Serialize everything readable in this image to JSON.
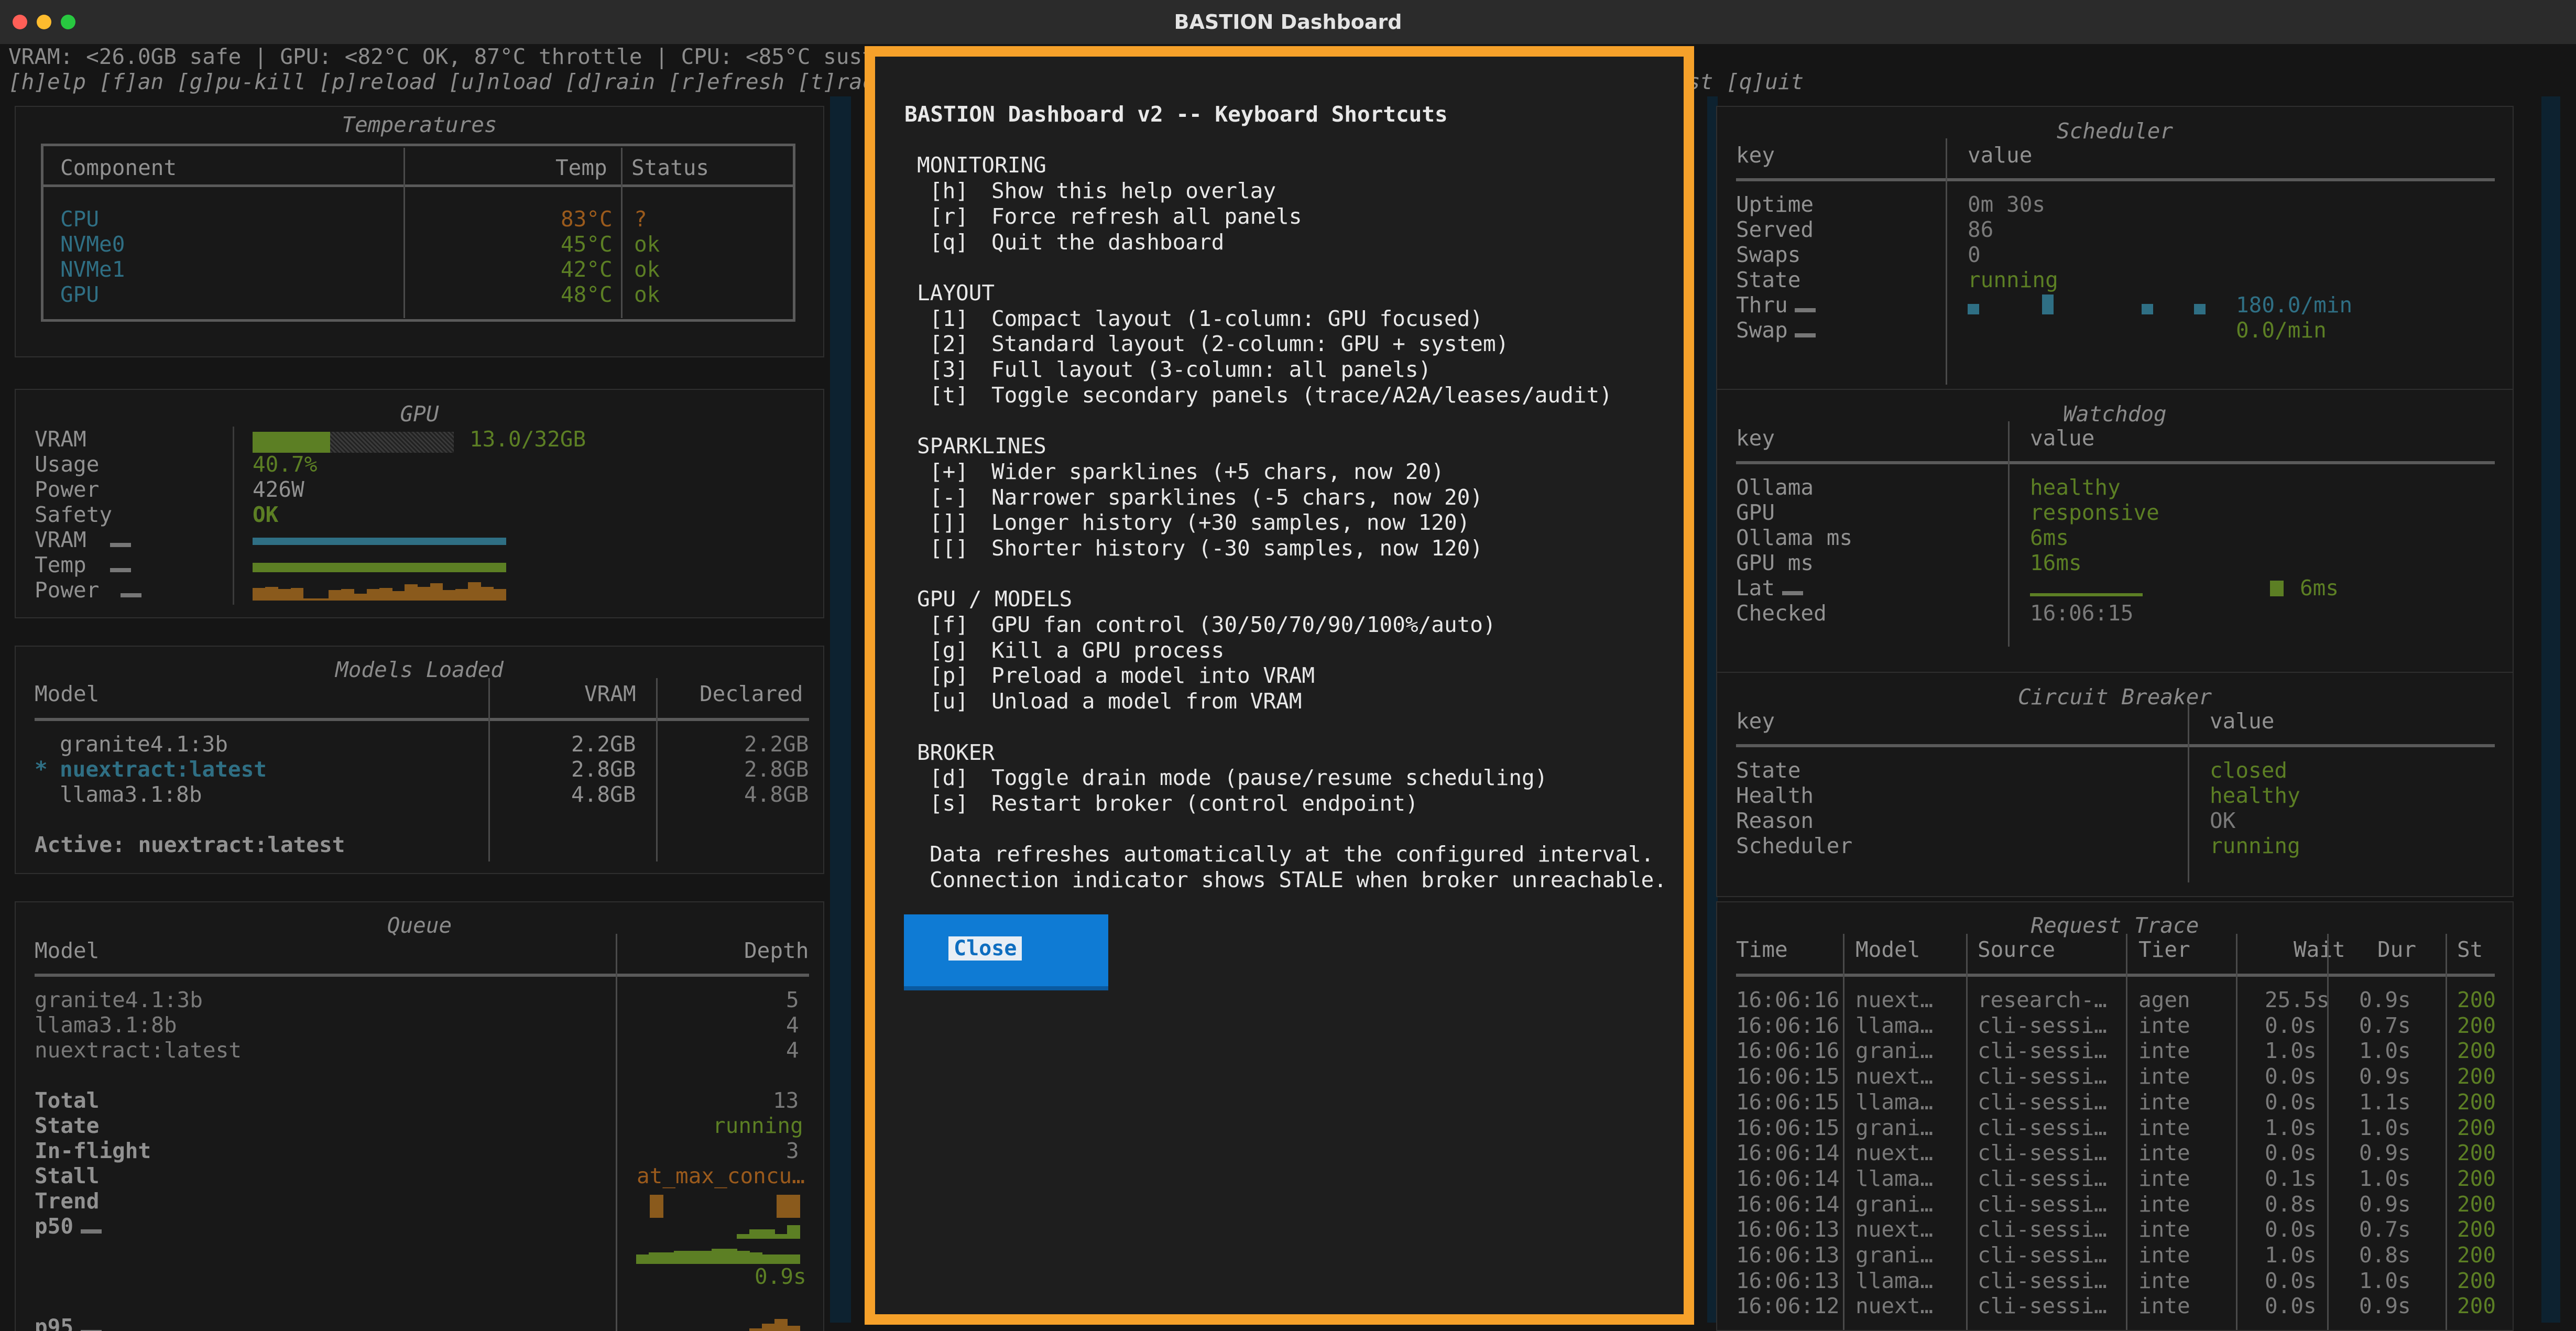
{
  "window": {
    "title": "BASTION Dashboard"
  },
  "status_line": "VRAM: <26.0GB safe | GPU: <82°C OK, 87°C throttle | CPU: <85°C sust",
  "keys_line": {
    "left": "[h]elp [f]an [g]pu-kill [p]reload [u]nload [d]rain [r]efresh [t]rac",
    "right": "st [q]uit"
  },
  "temperatures": {
    "title": "Temperatures",
    "headers": [
      "Component",
      "Temp",
      "Status"
    ],
    "rows": [
      {
        "component": "CPU",
        "temp": "83°C",
        "status": "?"
      },
      {
        "component": "NVMe0",
        "temp": "45°C",
        "status": "ok"
      },
      {
        "component": "NVMe1",
        "temp": "42°C",
        "status": "ok"
      },
      {
        "component": "GPU",
        "temp": "48°C",
        "status": "ok"
      }
    ]
  },
  "gpu": {
    "title": "GPU",
    "vram_label": "VRAM",
    "vram_value": "13.0/32GB",
    "vram_fraction": 0.406,
    "usage_label": "Usage",
    "usage_value": "40.7%",
    "power_label": "Power",
    "power_value": "426W",
    "safety_label": "Safety",
    "safety_value": "OK",
    "spark_vram": "VRAM",
    "spark_temp": "Temp",
    "spark_power": "Power",
    "power_spark": [
      0.55,
      0.6,
      0.5,
      0.55,
      0.1,
      0.1,
      0.45,
      0.5,
      0.3,
      0.5,
      0.55,
      0.4,
      0.7,
      0.6,
      0.75,
      0.45,
      0.5,
      0.8,
      0.6,
      0.5
    ]
  },
  "models_loaded": {
    "title": "Models Loaded",
    "headers": [
      "Model",
      "VRAM",
      "Declared"
    ],
    "rows": [
      {
        "marker": " ",
        "model": "granite4.1:3b",
        "vram": "2.2GB",
        "declared": "2.2GB"
      },
      {
        "marker": "*",
        "model": "nuextract:latest",
        "vram": "2.8GB",
        "declared": "2.8GB"
      },
      {
        "marker": " ",
        "model": "llama3.1:8b",
        "vram": "4.8GB",
        "declared": "4.8GB"
      }
    ],
    "active": "Active: nuextract:latest"
  },
  "queue": {
    "title": "Queue",
    "headers": [
      "Model",
      "Depth"
    ],
    "rows": [
      {
        "model": "granite4.1:3b",
        "depth": "5"
      },
      {
        "model": "llama3.1:8b",
        "depth": "4"
      },
      {
        "model": "nuextract:latest",
        "depth": "4"
      }
    ],
    "total_label": "Total",
    "total_value": "13",
    "state_label": "State",
    "state_value": "running",
    "inflight_label": "In-flight",
    "inflight_value": "3",
    "stall_label": "Stall",
    "stall_value": "at_max_concu…",
    "trend_label": "Trend",
    "p50_label": "p50",
    "p50_value": "0.9s",
    "p95_label": "p95"
  },
  "modal": {
    "title": "BASTION Dashboard v2 -- Keyboard Shortcuts",
    "sections": [
      {
        "name": "MONITORING",
        "items": [
          {
            "key": "[h]",
            "desc": "Show this help overlay"
          },
          {
            "key": "[r]",
            "desc": "Force refresh all panels"
          },
          {
            "key": "[q]",
            "desc": "Quit the dashboard"
          }
        ]
      },
      {
        "name": "LAYOUT",
        "items": [
          {
            "key": "[1]",
            "desc": "Compact layout (1-column: GPU focused)"
          },
          {
            "key": "[2]",
            "desc": "Standard layout (2-column: GPU + system)"
          },
          {
            "key": "[3]",
            "desc": "Full layout (3-column: all panels)"
          },
          {
            "key": "[t]",
            "desc": "Toggle secondary panels (trace/A2A/leases/audit)"
          }
        ]
      },
      {
        "name": "SPARKLINES",
        "items": [
          {
            "key": "[+]",
            "desc": "Wider sparklines (+5 chars, now 20)"
          },
          {
            "key": "[-]",
            "desc": "Narrower sparklines (-5 chars, now 20)"
          },
          {
            "key": "[]]",
            "desc": "Longer history (+30 samples, now 120)"
          },
          {
            "key": "[[]",
            "desc": "Shorter history (-30 samples, now 120)"
          }
        ]
      },
      {
        "name": "GPU / MODELS",
        "items": [
          {
            "key": "[f]",
            "desc": "GPU fan control (30/50/70/90/100%/auto)"
          },
          {
            "key": "[g]",
            "desc": "Kill a GPU process"
          },
          {
            "key": "[p]",
            "desc": "Preload a model into VRAM"
          },
          {
            "key": "[u]",
            "desc": "Unload a model from VRAM"
          }
        ]
      },
      {
        "name": "BROKER",
        "items": [
          {
            "key": "[d]",
            "desc": "Toggle drain mode (pause/resume scheduling)"
          },
          {
            "key": "[s]",
            "desc": "Restart broker (control endpoint)"
          }
        ]
      }
    ],
    "footer1": "Data refreshes automatically at the configured interval.",
    "footer2": "Connection indicator shows STALE when broker unreachable.",
    "close_label": "Close"
  },
  "scheduler": {
    "title": "Scheduler",
    "headers": [
      "key",
      "value"
    ],
    "rows": [
      {
        "k": "Uptime",
        "v": "0m 30s"
      },
      {
        "k": "Served",
        "v": "86"
      },
      {
        "k": "Swaps",
        "v": "0"
      },
      {
        "k": "State",
        "v": "running"
      },
      {
        "k": "Thru",
        "v": "180.0/min"
      },
      {
        "k": "Swap",
        "v": "0.0/min"
      }
    ]
  },
  "watchdog": {
    "title": "Watchdog",
    "headers": [
      "key",
      "value"
    ],
    "rows": [
      {
        "k": "Ollama",
        "v": "healthy"
      },
      {
        "k": "GPU",
        "v": "responsive"
      },
      {
        "k": "Ollama ms",
        "v": "6ms"
      },
      {
        "k": "GPU ms",
        "v": "16ms"
      },
      {
        "k": "Lat",
        "v": "6ms"
      },
      {
        "k": "Checked",
        "v": "16:06:15"
      }
    ]
  },
  "circuit_breaker": {
    "title": "Circuit Breaker",
    "headers": [
      "key",
      "value"
    ],
    "rows": [
      {
        "k": "State",
        "v": "closed"
      },
      {
        "k": "Health",
        "v": "healthy"
      },
      {
        "k": "Reason",
        "v": "OK"
      },
      {
        "k": "Scheduler",
        "v": "running"
      }
    ]
  },
  "request_trace": {
    "title": "Request Trace",
    "headers": [
      "Time",
      "Model",
      "Source",
      "Tier",
      "Wait",
      "Dur",
      "St"
    ],
    "rows": [
      [
        "16:06:16",
        "nuext…",
        "research-…",
        "agen",
        "25.5s",
        "0.9s",
        "200"
      ],
      [
        "16:06:16",
        "llama…",
        "cli-sessi…",
        "inte",
        "0.0s",
        "0.7s",
        "200"
      ],
      [
        "16:06:16",
        "grani…",
        "cli-sessi…",
        "inte",
        "1.0s",
        "1.0s",
        "200"
      ],
      [
        "16:06:15",
        "nuext…",
        "cli-sessi…",
        "inte",
        "0.0s",
        "0.9s",
        "200"
      ],
      [
        "16:06:15",
        "llama…",
        "cli-sessi…",
        "inte",
        "0.0s",
        "1.1s",
        "200"
      ],
      [
        "16:06:15",
        "grani…",
        "cli-sessi…",
        "inte",
        "1.0s",
        "1.0s",
        "200"
      ],
      [
        "16:06:14",
        "nuext…",
        "cli-sessi…",
        "inte",
        "0.0s",
        "0.9s",
        "200"
      ],
      [
        "16:06:14",
        "llama…",
        "cli-sessi…",
        "inte",
        "0.1s",
        "1.0s",
        "200"
      ],
      [
        "16:06:14",
        "grani…",
        "cli-sessi…",
        "inte",
        "0.8s",
        "0.9s",
        "200"
      ],
      [
        "16:06:13",
        "nuext…",
        "cli-sessi…",
        "inte",
        "0.0s",
        "0.7s",
        "200"
      ],
      [
        "16:06:13",
        "grani…",
        "cli-sessi…",
        "inte",
        "1.0s",
        "0.8s",
        "200"
      ],
      [
        "16:06:13",
        "llama…",
        "cli-sessi…",
        "inte",
        "0.0s",
        "1.0s",
        "200"
      ],
      [
        "16:06:12",
        "nuext…",
        "cli-sessi…",
        "inte",
        "0.0s",
        "0.9s",
        "200"
      ]
    ]
  },
  "colors": {
    "accent": "#f6a12a",
    "button": "#0f7bd4",
    "ok_green": "#5c7f24",
    "warn_orange": "#9a5a1c",
    "cyan": "#2f6f84"
  }
}
